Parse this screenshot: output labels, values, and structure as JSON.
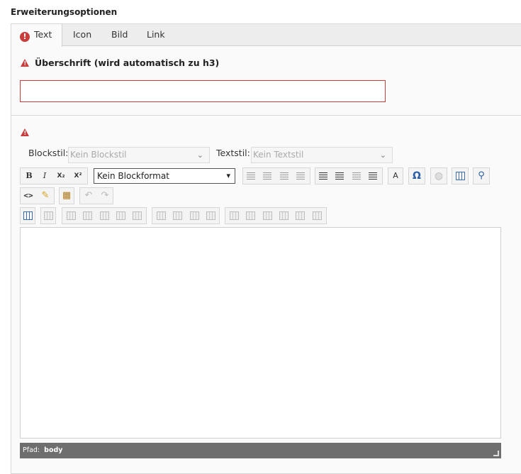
{
  "section": {
    "title": "Erweiterungsoptionen"
  },
  "tabs": [
    {
      "label": "Text",
      "active": true,
      "error": true
    },
    {
      "label": "Icon",
      "active": false
    },
    {
      "label": "Bild",
      "active": false
    },
    {
      "label": "Link",
      "active": false
    }
  ],
  "heading_field": {
    "label": "Überschrift (wird automatisch zu h3)",
    "value": ""
  },
  "styles": {
    "blockstil_label": "Blockstil:",
    "blockstil_value": "Kein Blockstil",
    "textstil_label": "Textstil:",
    "textstil_value": "Kein Textstil"
  },
  "toolbar": {
    "bold": "B",
    "italic": "I",
    "subscript": "X₂",
    "superscript": "X²",
    "block_format": "Kein Blockformat",
    "textcolor": "A",
    "special_chars": "Ω",
    "source": "<>"
  },
  "statusbar": {
    "path_label": "Pfad:",
    "path_value": "body"
  },
  "colors": {
    "error": "#c83c3c",
    "accent": "#3a6cb4"
  }
}
